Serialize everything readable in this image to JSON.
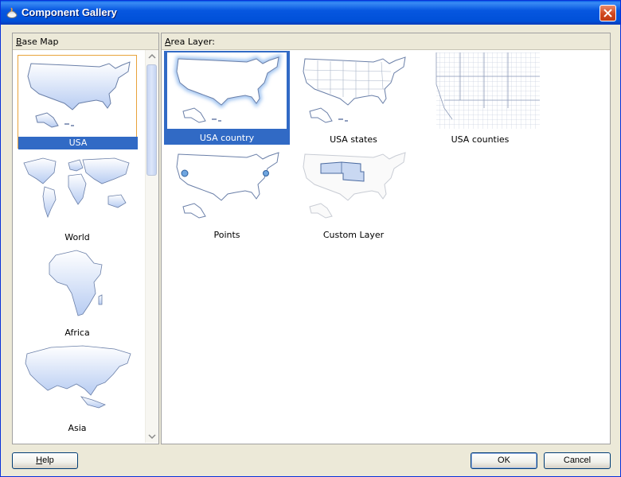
{
  "window": {
    "title": "Component Gallery"
  },
  "left_panel": {
    "header_prefix": "B",
    "header_rest": "ase Map",
    "items": [
      {
        "label": "USA",
        "selected": true
      },
      {
        "label": "World",
        "selected": false
      },
      {
        "label": "Africa",
        "selected": false
      },
      {
        "label": "Asia",
        "selected": false
      }
    ]
  },
  "right_panel": {
    "header_prefix": "A",
    "header_rest": "rea Layer:",
    "items": [
      {
        "label": "USA country",
        "selected": true
      },
      {
        "label": "USA states",
        "selected": false
      },
      {
        "label": "USA counties",
        "selected": false
      },
      {
        "label": "Points",
        "selected": false
      },
      {
        "label": "Custom Layer",
        "selected": false
      }
    ]
  },
  "buttons": {
    "help_prefix": "H",
    "help_rest": "elp",
    "ok": "OK",
    "cancel": "Cancel"
  },
  "colors": {
    "selection": "#316ac5",
    "titlebar": "#0757e0",
    "map_fill": "#dde8fb",
    "map_stroke": "#6a7fa8"
  },
  "icons": [
    "app-icon",
    "close-icon",
    "scroll-up-arrow-icon",
    "scroll-down-arrow-icon"
  ]
}
